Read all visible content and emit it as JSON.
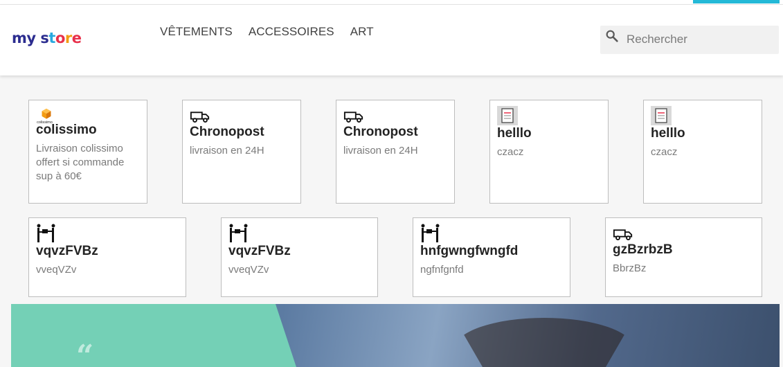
{
  "brand": {
    "logo_text": "my store"
  },
  "nav": {
    "items": [
      {
        "label": "Vêtements"
      },
      {
        "label": "Accessoires"
      },
      {
        "label": "Art"
      }
    ]
  },
  "search": {
    "placeholder": "Rechercher",
    "value": ""
  },
  "carriers": [
    {
      "icon": "colissimo-logo-icon",
      "title": "colissimo",
      "description": "Livraison colissimo offert si commande sup à 60€"
    },
    {
      "icon": "delivery-truck-icon",
      "title": "Chronopost",
      "description": "livraison en 24H"
    },
    {
      "icon": "delivery-truck-icon",
      "title": "Chronopost",
      "description": "livraison en 24H"
    },
    {
      "icon": "image-placeholder-icon",
      "title": "helllo",
      "description": "czacz"
    },
    {
      "icon": "image-placeholder-icon",
      "title": "helllo",
      "description": "czacz"
    },
    {
      "icon": "hand-delivery-icon",
      "title": "vqvzFVBz",
      "description": "vveqVZv"
    },
    {
      "icon": "hand-delivery-icon",
      "title": "vqvzFVBz",
      "description": "vveqVZv"
    },
    {
      "icon": "hand-delivery-icon",
      "title": "hnfgwngfwngfd",
      "description": "ngfnfgnfd"
    },
    {
      "icon": "delivery-truck-icon",
      "title": "gzBzrbzB",
      "description": "BbrzBz"
    }
  ],
  "colissimo_logo_caption": "colissimo",
  "hero": {
    "quote_mark": "“"
  },
  "colors": {
    "accent": "#24b9d7",
    "teal": "#74d0b6"
  }
}
